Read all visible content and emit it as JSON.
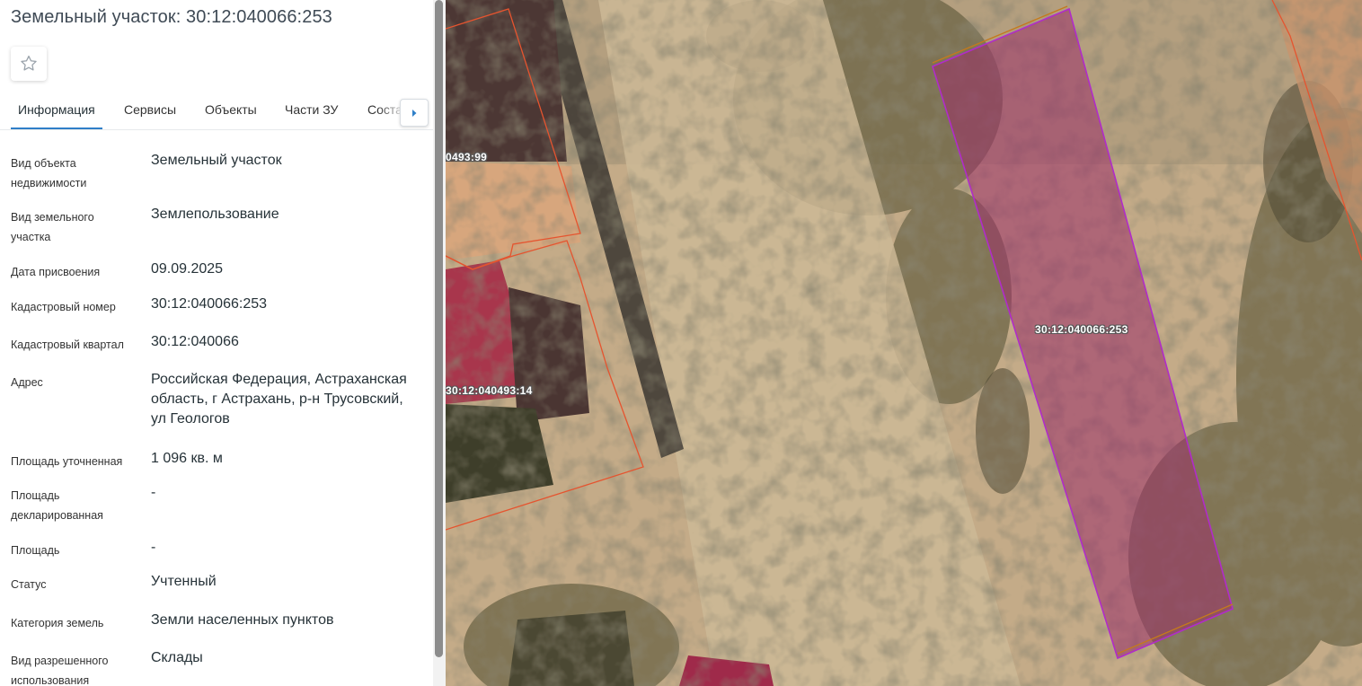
{
  "panel": {
    "title": "Земельный участок: 30:12:040066:253",
    "favorite_icon": "star-outline-icon"
  },
  "tabs": [
    {
      "label": "Информация",
      "active": true
    },
    {
      "label": "Сервисы",
      "active": false
    },
    {
      "label": "Объекты",
      "active": false
    },
    {
      "label": "Части ЗУ",
      "active": false
    },
    {
      "label": "Состав",
      "active": false
    }
  ],
  "tabs_scroll_icon": "chevron-right-icon",
  "info": [
    {
      "label": "Вид объекта недвижимости",
      "value": "Земельный участок"
    },
    {
      "label": "Вид земельного участка",
      "value": "Землепользование"
    },
    {
      "label": "Дата присвоения",
      "value": "09.09.2025"
    },
    {
      "label": "Кадастровый номер",
      "value": "30:12:040066:253"
    },
    {
      "label": "Кадастровый квартал",
      "value": "30:12:040066"
    },
    {
      "label": "Адрес",
      "value": "Российская Федерация, Астраханская область, г Астрахань, р-н Трусовский, ул Геологов"
    },
    {
      "label": "Площадь уточненная",
      "value": "1 096 кв. м"
    },
    {
      "label": "Площадь декларированная",
      "value": "-"
    },
    {
      "label": "Площадь",
      "value": "-"
    },
    {
      "label": "Статус",
      "value": "Учтенный"
    },
    {
      "label": "Категория земель",
      "value": "Земли населенных пунктов"
    },
    {
      "label": "Вид разрешенного использования",
      "value": "Склады"
    }
  ],
  "map": {
    "labels": {
      "selected": "30:12:040066:253",
      "neighbor_1": "0493:99",
      "neighbor_2": "30:12:040493:14"
    },
    "colors": {
      "selected_fill": "#9c2f6a",
      "selected_stroke": "#b02cc9",
      "parcel_stroke": "#e5542f",
      "tab_active": "#2f7fc8"
    }
  }
}
